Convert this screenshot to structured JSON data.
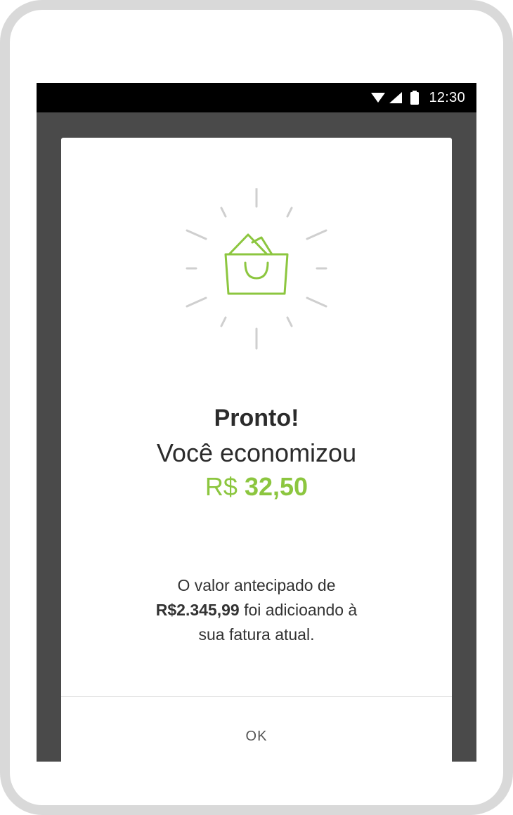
{
  "status_bar": {
    "time": "12:30",
    "icons": [
      "wifi-icon",
      "signal-icon",
      "battery-icon"
    ]
  },
  "dialog": {
    "illustration_icon": "shopping-bag-icon",
    "title": "Pronto!",
    "subtitle": "Você economizou",
    "currency": "R$",
    "amount": "32,50",
    "message": {
      "line1": "O valor antecipado de",
      "amount": "R$2.345,99",
      "line2_rest": "foi adicioando à",
      "line3": "sua fatura atual."
    },
    "ok_label": "OK"
  },
  "colors": {
    "accent": "#8cc63f",
    "overlay": "#4a4a4a",
    "status_bar": "#000000",
    "frame": "#d9d9d9"
  }
}
